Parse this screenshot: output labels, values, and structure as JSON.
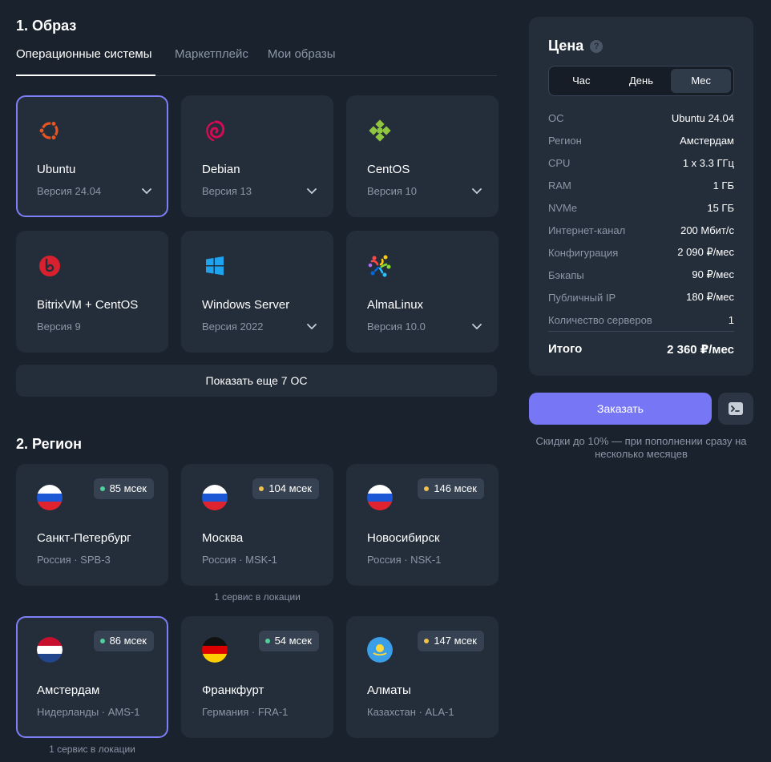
{
  "image_section": {
    "title": "1. Образ",
    "tabs": [
      {
        "label": "Операционные системы",
        "active": true
      },
      {
        "label": "Маркетплейс",
        "active": false
      },
      {
        "label": "Мои образы",
        "active": false
      }
    ],
    "os_cards": [
      {
        "name": "Ubuntu",
        "version": "Версия 24.04",
        "icon": "ubuntu-icon",
        "selected": true,
        "dropdown": true
      },
      {
        "name": "Debian",
        "version": "Версия 13",
        "icon": "debian-icon",
        "selected": false,
        "dropdown": true
      },
      {
        "name": "CentOS",
        "version": "Версия 10",
        "icon": "centos-icon",
        "selected": false,
        "dropdown": true
      },
      {
        "name": "BitrixVM + CentOS",
        "version": "Версия 9",
        "icon": "bitrix-icon",
        "selected": false,
        "dropdown": false
      },
      {
        "name": "Windows Server",
        "version": "Версия 2022",
        "icon": "windows-icon",
        "selected": false,
        "dropdown": true
      },
      {
        "name": "AlmaLinux",
        "version": "Версия 10.0",
        "icon": "almalinux-icon",
        "selected": false,
        "dropdown": true
      }
    ],
    "show_more_label": "Показать еще 7 ОС"
  },
  "region_section": {
    "title": "2. Регион",
    "regions": [
      {
        "city": "Санкт-Петербург",
        "location": "Россия · SPB-3",
        "ping": "85 мсек",
        "ping_color": "#4fd19a",
        "flag": "russia",
        "selected": false,
        "note": ""
      },
      {
        "city": "Москва",
        "location": "Россия · MSK-1",
        "ping": "104 мсек",
        "ping_color": "#f2c14e",
        "flag": "russia",
        "selected": false,
        "note": "1 сервис в локации"
      },
      {
        "city": "Новосибирск",
        "location": "Россия · NSK-1",
        "ping": "146 мсек",
        "ping_color": "#f2c14e",
        "flag": "russia",
        "selected": false,
        "note": ""
      },
      {
        "city": "Амстердам",
        "location": "Нидерланды · AMS-1",
        "ping": "86 мсек",
        "ping_color": "#4fd19a",
        "flag": "netherlands",
        "selected": true,
        "note": "1 сервис в локации"
      },
      {
        "city": "Франкфурт",
        "location": "Германия · FRA-1",
        "ping": "54 мсек",
        "ping_color": "#4fd19a",
        "flag": "germany",
        "selected": false,
        "note": ""
      },
      {
        "city": "Алматы",
        "location": "Казахстан · ALA-1",
        "ping": "147 мсек",
        "ping_color": "#f2c14e",
        "flag": "kazakhstan",
        "selected": false,
        "note": ""
      }
    ]
  },
  "price": {
    "title": "Цена",
    "periods": [
      {
        "label": "Час",
        "active": false
      },
      {
        "label": "День",
        "active": false
      },
      {
        "label": "Мес",
        "active": true
      }
    ],
    "rows": [
      {
        "key": "ОС",
        "value": "Ubuntu 24.04"
      },
      {
        "key": "Регион",
        "value": "Амстердам"
      },
      {
        "key": "CPU",
        "value": "1 x 3.3 ГГц"
      },
      {
        "key": "RAM",
        "value": "1 ГБ"
      },
      {
        "key": "NVMe",
        "value": "15 ГБ"
      },
      {
        "key": "Интернет-канал",
        "value": "200 Мбит/с"
      },
      {
        "key": "Конфигурация",
        "value": "2 090 ₽/мес"
      },
      {
        "key": "Бэкапы",
        "value": "90 ₽/мес"
      },
      {
        "key": "Публичный IP",
        "value": "180 ₽/мес"
      },
      {
        "key": "Количество серверов",
        "value": "1"
      }
    ],
    "total_label": "Итого",
    "total_value": "2 360 ₽/мес"
  },
  "order_label": "Заказать",
  "discount_note": "Скидки до 10% — при пополнении сразу на несколько месяцев",
  "colors": {
    "accent": "#7777f6",
    "background": "#1a222d",
    "card": "#242e3b"
  }
}
